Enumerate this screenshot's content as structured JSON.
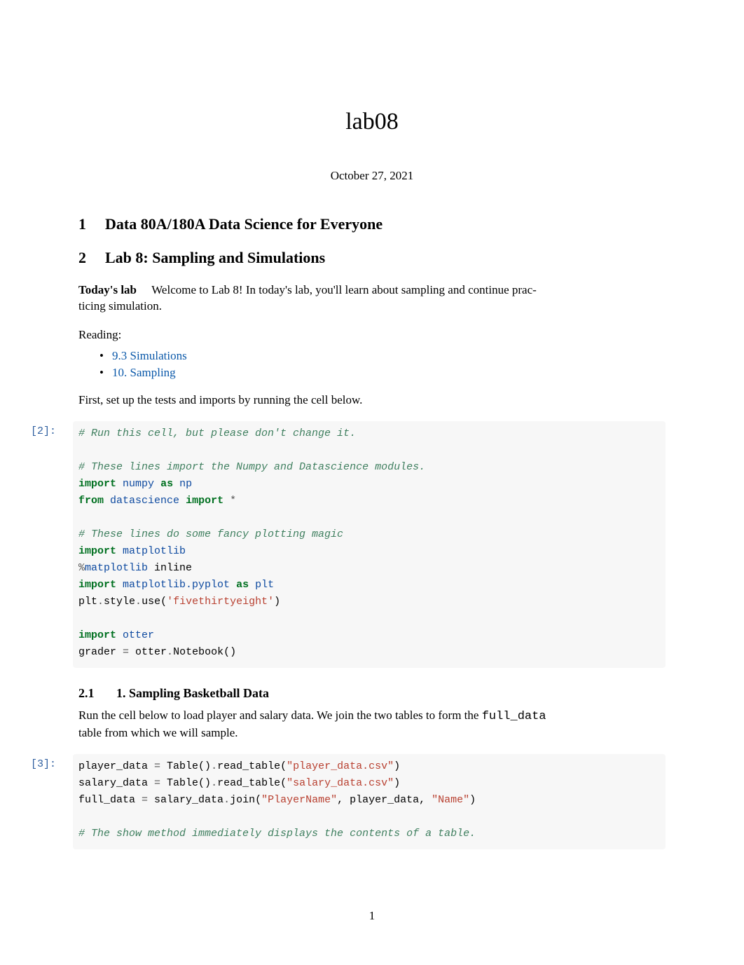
{
  "title": "lab08",
  "date": "October 27, 2021",
  "h1_1": {
    "num": "1",
    "text": "Data 80A/180A Data Science for Everyone"
  },
  "h1_2": {
    "num": "2",
    "text": "Lab 8: Sampling and Simulations"
  },
  "intro_bold": "Today's lab",
  "intro_text": "Welcome to Lab 8! In today's lab, you'll learn about sampling and continue prac-",
  "intro_text2": "ticing simulation.",
  "reading_label": "Reading:",
  "reading_links": {
    "a": "9.3 Simulations",
    "b": "10. Sampling"
  },
  "setup_text": "First, set up the tests and imports by running the cell below.",
  "cell1": {
    "prompt": "[2]:",
    "lines": {
      "c1": "# Run this cell, but please don't change it.",
      "c2": "# These lines import the Numpy and Datascience modules.",
      "kw_import1": "import",
      "mod_numpy": "numpy",
      "kw_as1": "as",
      "mod_np": "np",
      "kw_from": "from",
      "mod_ds": "datascience",
      "kw_import2": "import",
      "star": "*",
      "c3": "# These lines do some fancy plotting magic",
      "kw_import3": "import",
      "mod_mpl": "matplotlib",
      "magic": "%",
      "magic_name": "matplotlib",
      "magic_arg": " inline",
      "kw_import4": "import",
      "mod_mpl_py": "matplotlib.pyplot",
      "kw_as2": "as",
      "mod_plt": "plt",
      "plt_call_1": "plt",
      "dot1": ".",
      "plt_style": "style",
      "dot2": ".",
      "plt_use": "use(",
      "str_538": "'fivethirtyeight'",
      "close_paren1": ")",
      "kw_import5": "import",
      "mod_otter": "otter",
      "grader_assign": "grader ",
      "eq1": "=",
      "otter_nb": " otter",
      "dot3": ".",
      "nb_call": "Notebook()"
    }
  },
  "h2": {
    "num": "2.1",
    "text": "1. Sampling Basketball Data"
  },
  "sec_p1a": "Run the cell below to load player and salary data. We join the two tables to form the ",
  "sec_p1_code": "full_data",
  "sec_p2": "table from which we will sample.",
  "cell2": {
    "prompt": "[3]:",
    "lines": {
      "pd_var": "player_data ",
      "eq": "=",
      "table_call1": " Table()",
      "dot": ".",
      "rt": "read_table(",
      "str1": "\"player_data.csv\"",
      "close1": ")",
      "sd_var": "salary_data ",
      "table_call2": " Table()",
      "str2": "\"salary_data.csv\"",
      "close2": ")",
      "fd_var": "full_data ",
      "sd_ref": " salary_data",
      "join": "join(",
      "str3": "\"PlayerName\"",
      "comma": ", player_data, ",
      "str4": "\"Name\"",
      "close3": ")",
      "c_show": "# The show method immediately displays the contents of a table."
    }
  },
  "page_number": "1"
}
